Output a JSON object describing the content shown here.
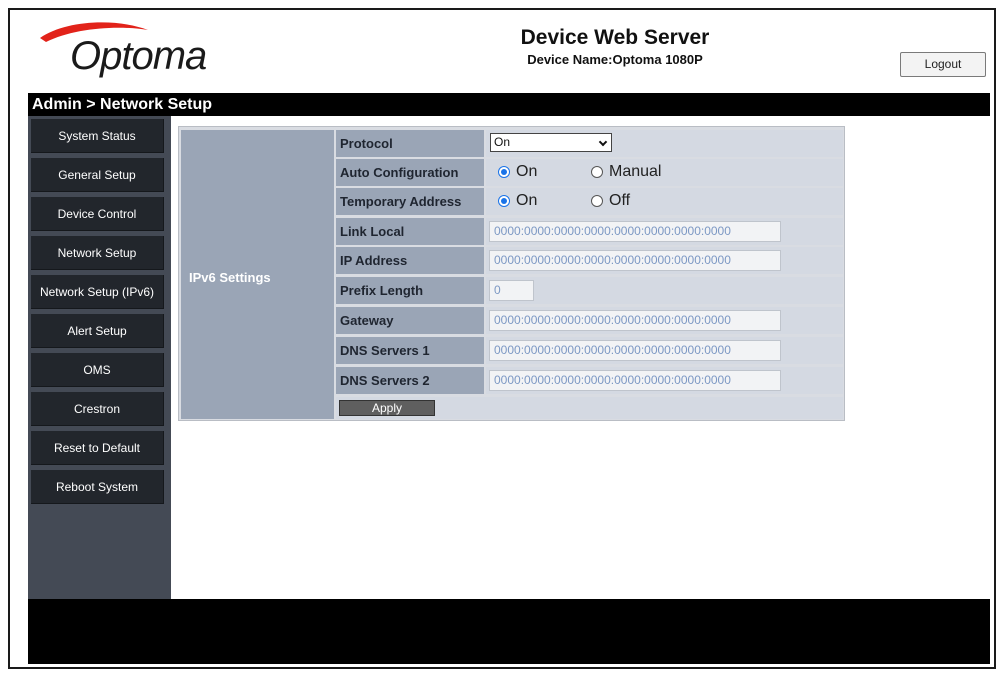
{
  "header": {
    "brand": "Optoma",
    "title": "Device Web Server",
    "device_name": "Device Name:Optoma 1080P",
    "logout_label": "Logout"
  },
  "breadcrumb": "Admin > Network Setup",
  "sidebar": {
    "items": [
      {
        "label": "System Status"
      },
      {
        "label": "General Setup"
      },
      {
        "label": "Device Control"
      },
      {
        "label": "Network Setup"
      },
      {
        "label": "Network Setup (IPv6)"
      },
      {
        "label": "Alert Setup"
      },
      {
        "label": "OMS"
      },
      {
        "label": "Crestron"
      },
      {
        "label": "Reset to Default"
      },
      {
        "label": "Reboot System"
      }
    ]
  },
  "settings": {
    "section_label": "IPv6 Settings",
    "protocol": {
      "label": "Protocol",
      "value": "On"
    },
    "auto_config": {
      "label": "Auto Configuration",
      "option_a": "On",
      "option_b": "Manual",
      "selected": "On"
    },
    "temp_address": {
      "label": "Temporary Address",
      "option_a": "On",
      "option_b": "Off",
      "selected": "On"
    },
    "link_local": {
      "label": "Link Local",
      "value": "0000:0000:0000:0000:0000:0000:0000:0000"
    },
    "ip_address": {
      "label": "IP Address",
      "value": "0000:0000:0000:0000:0000:0000:0000:0000"
    },
    "prefix_length": {
      "label": "Prefix Length",
      "value": "0"
    },
    "gateway": {
      "label": "Gateway",
      "value": "0000:0000:0000:0000:0000:0000:0000:0000"
    },
    "dns1": {
      "label": "DNS Servers 1",
      "value": "0000:0000:0000:0000:0000:0000:0000:0000"
    },
    "dns2": {
      "label": "DNS Servers 2",
      "value": "0000:0000:0000:0000:0000:0000:0000:0000"
    },
    "apply_label": "Apply"
  },
  "colors": {
    "brand_red": "#e2231a",
    "sidebar_bg": "#444a55",
    "nav_item_bg": "#22262c",
    "label_cell_bg": "#9aa5b6",
    "radio_accent": "#1a73e8"
  }
}
